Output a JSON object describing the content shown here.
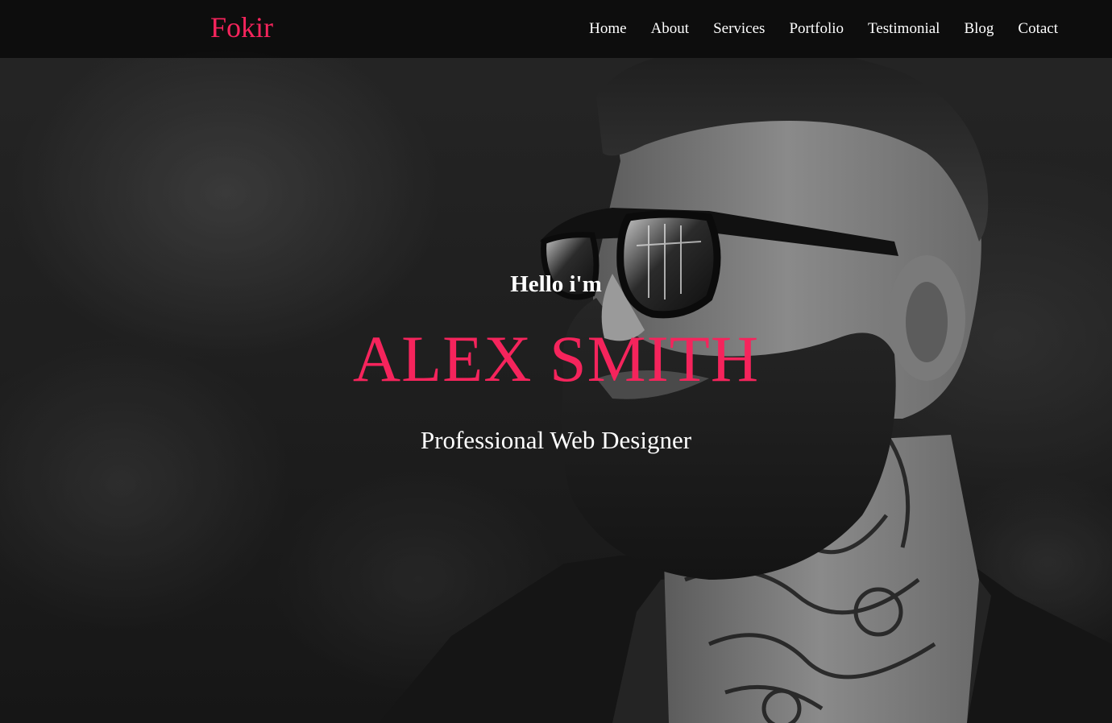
{
  "navbar": {
    "brand": "Fokir",
    "links": [
      "Home",
      "About",
      "Services",
      "Portfolio",
      "Testimonial",
      "Blog",
      "Cotact"
    ]
  },
  "hero": {
    "greeting": "Hello i'm",
    "name": "ALEX SMITH",
    "role": "Professional Web Designer",
    "image": "bearded-man-sunglasses-portrait"
  },
  "colors": {
    "accent": "#f5245c",
    "navbar_bg": "#0c0c0c",
    "text": "#ffffff"
  }
}
